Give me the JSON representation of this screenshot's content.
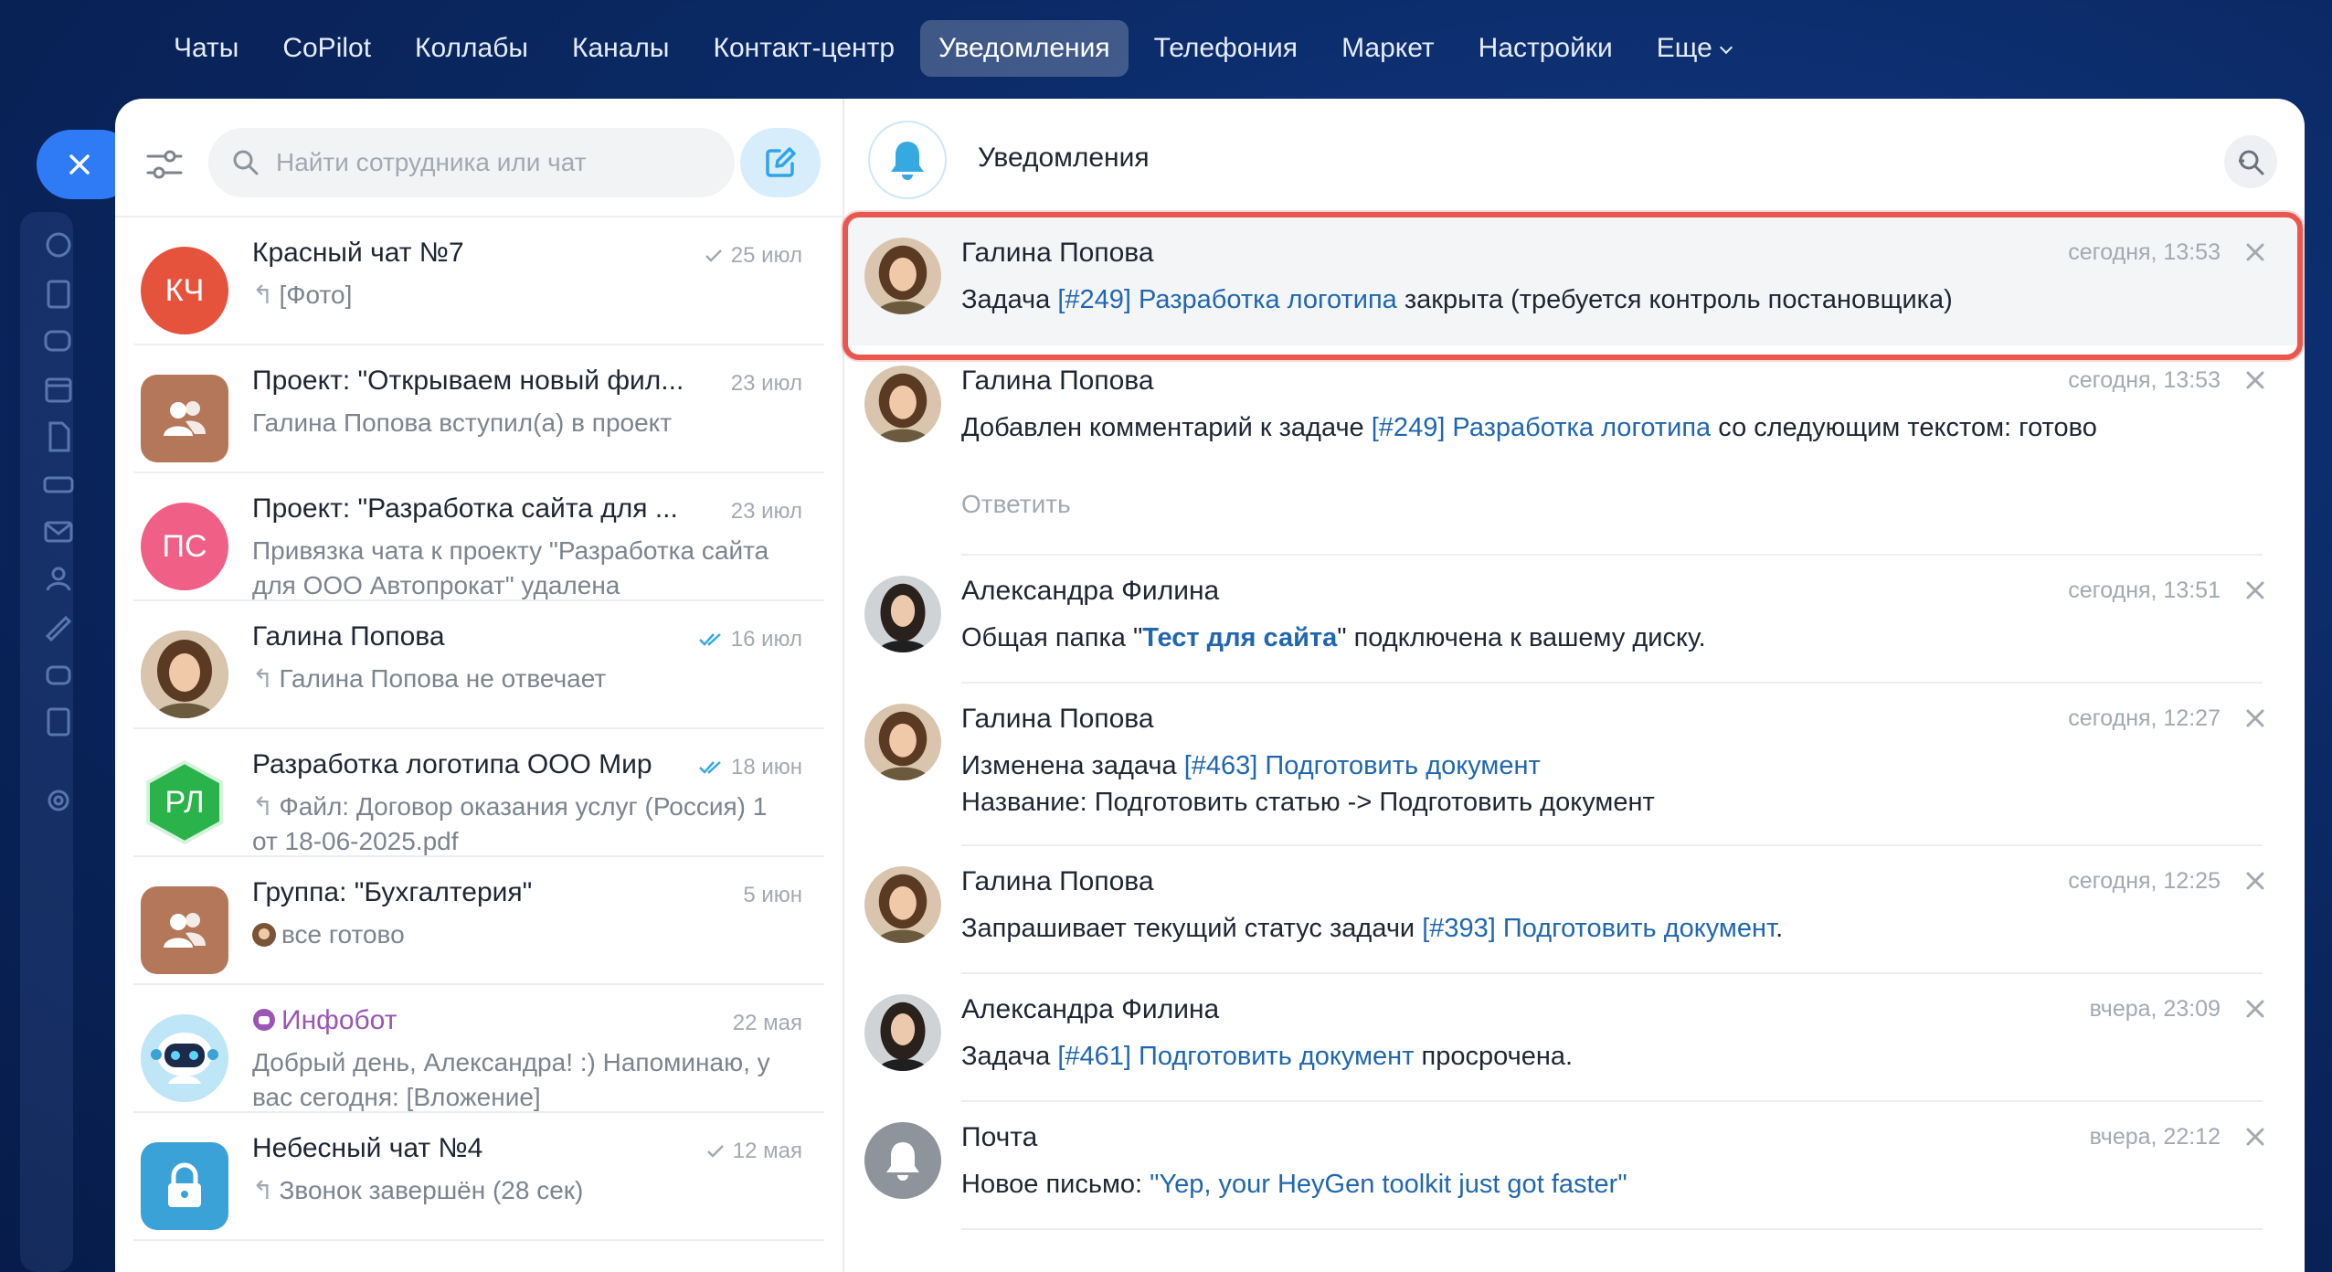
{
  "topnav": {
    "items": [
      "Чаты",
      "CoPilot",
      "Коллабы",
      "Каналы",
      "Контакт-центр",
      "Уведомления",
      "Телефония",
      "Маркет",
      "Настройки",
      "Еще"
    ],
    "active_index": 5
  },
  "sidebar": {
    "search_placeholder": "Найти сотрудника или чат"
  },
  "chats": [
    {
      "title": "Красный чат №7",
      "date": "25 июл",
      "status": "sent",
      "preview": "[Фото]",
      "reply": true,
      "avatar_text": "КЧ",
      "avatar_color": "#e6533c"
    },
    {
      "title": "Проект: \"Открываем новый фил...",
      "date": "23 июл",
      "status": "",
      "preview": "Галина Попова вступил(а) в проект",
      "reply": false,
      "avatar_color": "#b4775a"
    },
    {
      "title": "Проект: \"Разработка сайта для ...",
      "date": "23 июл",
      "status": "",
      "preview": "Привязка чата к проекту \"Разработка сайта для ООО Автопрокат\" удалена",
      "reply": false,
      "avatar_text": "ПС",
      "avatar_color": "#ef5f86"
    },
    {
      "title": "Галина Попова",
      "date": "16 июл",
      "status": "read",
      "preview": "Галина Попова не отвечает",
      "reply": true
    },
    {
      "title": "Разработка логотипа ООО Мир",
      "date": "18 июн",
      "status": "read",
      "preview": "Файл: Договор оказания услуг (Россия) 1 от 18-06-2025.pdf",
      "reply": true,
      "avatar_text": "РЛ",
      "avatar_color": "#29b34a"
    },
    {
      "title": "Группа: \"Бухгалтерия\"",
      "date": "5 июн",
      "status": "",
      "preview": "все готово",
      "reply": false,
      "avatar_color": "#b4775a"
    },
    {
      "title": "Инфобот",
      "date": "22 мая",
      "status": "",
      "preview": "Добрый день, Александра! :) Напоминаю, у вас сегодня: [Вложение]",
      "reply": false
    },
    {
      "title": "Небесный чат №4",
      "date": "12 мая",
      "status": "sent",
      "preview": "Звонок завершён (28 сек)",
      "reply": true,
      "avatar_color": "#3aa2d6"
    }
  ],
  "notifications_panel": {
    "title": "Уведомления"
  },
  "notifications": [
    {
      "author": "Галина Попова",
      "time": "сегодня, 13:53",
      "pre": "Задача ",
      "link": "[#249] Разработка логотипа",
      "post": " закрыта (требуется контроль постановщика)"
    },
    {
      "author": "Галина Попова",
      "time": "сегодня, 13:53",
      "pre": "Добавлен комментарий к задаче ",
      "link": "[#249] Разработка логотипа",
      "post": " со следующим текстом: готово",
      "reply_label": "Ответить"
    },
    {
      "author": "Александра Филина",
      "time": "сегодня, 13:51",
      "pre": "Общая папка \"",
      "link": "Тест для сайта",
      "post": "\" подключена к вашему диску."
    },
    {
      "author": "Галина Попова",
      "time": "сегодня, 12:27",
      "pre": "Изменена задача ",
      "link": "[#463] Подготовить документ",
      "post": "",
      "line2": "Название: Подготовить статью -> Подготовить документ"
    },
    {
      "author": "Галина Попова",
      "time": "сегодня, 12:25",
      "pre": "Запрашивает текущий статус задачи ",
      "link": "[#393] Подготовить документ",
      "post": "."
    },
    {
      "author": "Александра Филина",
      "time": "вчера, 23:09",
      "pre": "Задача ",
      "link": "[#461] Подготовить документ",
      "post": " просрочена."
    },
    {
      "author": "Почта",
      "time": "вчера, 22:12",
      "pre": "Новое письмо: ",
      "link": "\"Yep, your HeyGen toolkit just got faster\"",
      "post": ""
    }
  ]
}
